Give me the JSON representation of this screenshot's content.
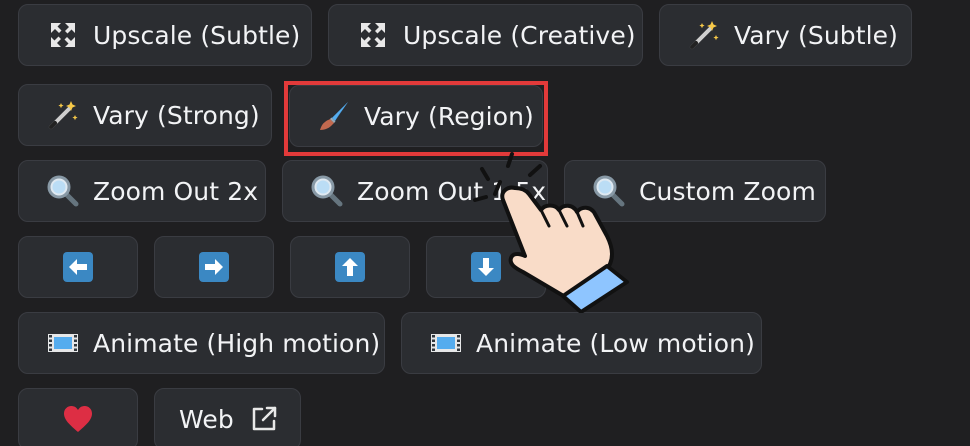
{
  "buttons": {
    "upscale_subtle": "Upscale (Subtle)",
    "upscale_creative": "Upscale (Creative)",
    "vary_subtle": "Vary (Subtle)",
    "vary_strong": "Vary (Strong)",
    "vary_region": "Vary (Region)",
    "zoom_out_2x": "Zoom Out 2x",
    "zoom_out_15x": "Zoom Out 1.5x",
    "custom_zoom": "Custom Zoom",
    "animate_high": "Animate (High motion)",
    "animate_low": "Animate (Low motion)",
    "web": "Web"
  },
  "icons": {
    "upscale": "expand-arrows-icon",
    "vary": "magic-wand-icon",
    "region": "paintbrush-icon",
    "zoom": "magnifier-icon",
    "pan": [
      "arrow-left-icon",
      "arrow-right-icon",
      "arrow-up-icon",
      "arrow-down-icon"
    ],
    "animate": "film-strip-icon",
    "like": "heart-icon",
    "external": "external-link-icon",
    "pointer": "pointing-hand-icon"
  },
  "colors": {
    "background": "#1f1f21",
    "button": "#2b2d31",
    "text": "#f2f3f5",
    "highlight": "#e23a3a",
    "pan_blue": "#3b88c3",
    "heart": "#dd2e44"
  }
}
